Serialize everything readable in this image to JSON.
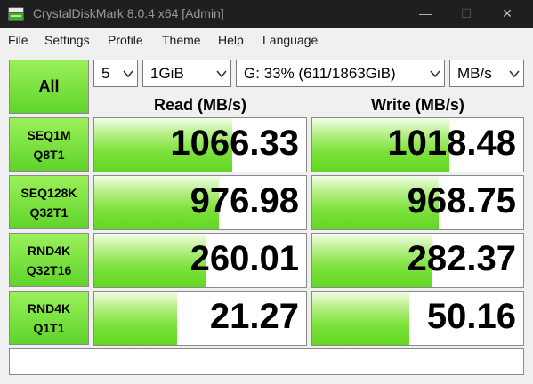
{
  "window": {
    "title": "CrystalDiskMark 8.0.4 x64 [Admin]"
  },
  "window_controls": {
    "minimize": "—",
    "maximize": "☐",
    "close": "✕"
  },
  "menu": {
    "items": [
      {
        "label": "File"
      },
      {
        "label": "Settings"
      },
      {
        "label": "Profile"
      },
      {
        "label": "Theme"
      },
      {
        "label": "Help"
      },
      {
        "label": "Language"
      }
    ]
  },
  "controls": {
    "all_label": "All",
    "count": "5",
    "size": "1GiB",
    "drive": "G: 33% (611/1863GiB)",
    "unit": "MB/s"
  },
  "headers": {
    "read": "Read (MB/s)",
    "write": "Write (MB/s)"
  },
  "tests": [
    {
      "line1": "SEQ1M",
      "line2": "Q8T1",
      "read": "1066.33",
      "write": "1018.48",
      "read_fill": 0.65,
      "write_fill": 0.65
    },
    {
      "line1": "SEQ128K",
      "line2": "Q32T1",
      "read": "976.98",
      "write": "968.75",
      "read_fill": 0.59,
      "write_fill": 0.6
    },
    {
      "line1": "RND4K",
      "line2": "Q32T16",
      "read": "260.01",
      "write": "282.37",
      "read_fill": 0.53,
      "write_fill": 0.57
    },
    {
      "line1": "RND4K",
      "line2": "Q1T1",
      "read": "21.27",
      "write": "50.16",
      "read_fill": 0.39,
      "write_fill": 0.46
    }
  ],
  "comment": "",
  "colors": {
    "accent_green": "#62d722",
    "titlebar": "#1f1f1f"
  }
}
